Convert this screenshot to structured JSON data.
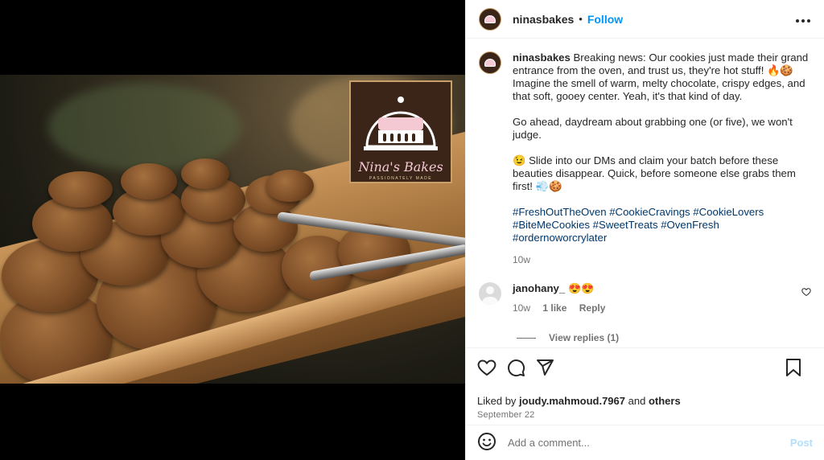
{
  "post": {
    "username": "ninasbakes",
    "separator": "•",
    "follow_label": "Follow",
    "more_label": "•••"
  },
  "logo": {
    "brand": "Nina's Bakes",
    "tagline": "PASSIONATELY MADE"
  },
  "caption": {
    "username": "ninasbakes",
    "p1": "Breaking news: Our cookies just made their grand entrance from the oven, and trust us, they're hot stuff! 🔥🍪 Imagine the smell of warm, melty chocolate, crispy edges, and that soft, gooey center. Yeah, it's that kind of day.",
    "p2": "Go ahead, daydream about grabbing one (or five), we won't judge.",
    "p3": "😉 Slide into our DMs and claim your batch before these beauties disappear. Quick, before someone else grabs them first! 💨🍪",
    "hashtags": "#FreshOutTheOven #CookieCravings #CookieLovers #BiteMeCookies #SweetTreats #OvenFresh #ordernoworcrylater",
    "time": "10w"
  },
  "comment": {
    "username": "janohany_",
    "text": "😍😍",
    "time": "10w",
    "likes": "1 like",
    "reply_label": "Reply",
    "view_replies": "View replies (1)"
  },
  "actions": {
    "liked_prefix": "Liked by",
    "liked_user": "joudy.mahmoud.7967",
    "liked_and": "and",
    "liked_others": "others",
    "date": "September 22"
  },
  "composer": {
    "placeholder": "Add a comment...",
    "post_label": "Post"
  },
  "icons": {
    "like": "heart-icon",
    "comment": "comment-icon",
    "share": "share-icon",
    "save": "bookmark-icon",
    "emoji": "emoji-icon",
    "more": "more-icon"
  },
  "colors": {
    "accent": "#0095f6",
    "hashtag": "#00376b",
    "post_disabled": "#b2dffc",
    "muted": "#737373"
  }
}
